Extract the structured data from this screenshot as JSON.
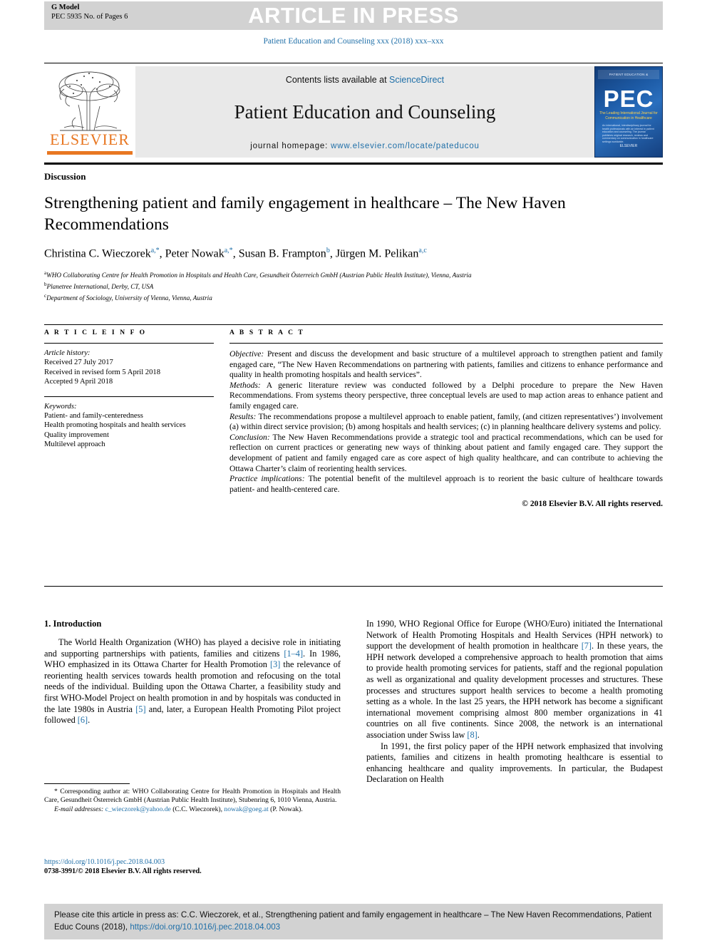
{
  "header": {
    "gmodel_label": "G Model",
    "gmodel_id": "PEC 5935 No. of Pages 6",
    "article_in_press": "ARTICLE IN PRESS",
    "journal_citation_line": "Patient Education and Counseling xxx (2018) xxx–xxx"
  },
  "masthead": {
    "contents_prefix": "Contents lists available at ",
    "contents_link": "ScienceDirect",
    "journal_name": "Patient Education and Counseling",
    "homepage_prefix": "journal homepage: ",
    "homepage_url": "www.elsevier.com/locate/pateducou",
    "publisher_logo_text": "ELSEVIER",
    "cover": {
      "top_strip": "PATIENT EDUCATION & COUNSELING",
      "big_title": "PEC",
      "subtitle": "The Leading International Journal\nfor Communication in Healthcare",
      "body_blurb": "An international, interdisciplinary journal for health professionals with an interest in patient education and counseling. The journal publishes original research, reviews and commentary on communication in healthcare settings worldwide.",
      "footer": "ELSEVIER"
    },
    "link_color": "#1f6fa8",
    "elsevier_orange": "#e87722"
  },
  "article": {
    "kind": "Discussion",
    "title": "Strengthening patient and family engagement in healthcare – The New Haven Recommendations",
    "authors": [
      {
        "name": "Christina C. Wieczorek",
        "sup": "a,*"
      },
      {
        "name": "Peter Nowak",
        "sup": "a,*"
      },
      {
        "name": "Susan B. Frampton",
        "sup": "b"
      },
      {
        "name": "Jürgen M. Pelikan",
        "sup": "a,c"
      }
    ],
    "affiliations": [
      {
        "marker": "a",
        "text": "WHO Collaborating Centre for Health Promotion in Hospitals and Health Care, Gesundheit Österreich GmbH (Austrian Public Health Institute), Vienna, Austria"
      },
      {
        "marker": "b",
        "text": "Planetree International, Derby, CT, USA"
      },
      {
        "marker": "c",
        "text": "Department of Sociology, University of Vienna, Vienna, Austria"
      }
    ]
  },
  "article_info": {
    "heading": "A R T I C L E   I N F O",
    "history_label": "Article history:",
    "history": [
      "Received 27 July 2017",
      "Received in revised form 5 April 2018",
      "Accepted 9 April 2018"
    ],
    "keywords_label": "Keywords:",
    "keywords": [
      "Patient- and family-centeredness",
      "Health promoting hospitals and health services",
      "Quality improvement",
      "Multilevel approach"
    ]
  },
  "abstract": {
    "heading": "A B S T R A C T",
    "sections": [
      {
        "label": "Objective:",
        "text": " Present and discuss the development and basic structure of a multilevel approach to strengthen patient and family engaged care, “The New Haven Recommendations on partnering with patients, families and citizens to enhance performance and quality in health promoting hospitals and health services”."
      },
      {
        "label": "Methods:",
        "text": " A generic literature review was conducted followed by a Delphi procedure to prepare the New Haven Recommendations. From systems theory perspective, three conceptual levels are used to map action areas to enhance patient and family engaged care."
      },
      {
        "label": "Results:",
        "text": " The recommendations propose a multilevel approach to enable patient, family, (and citizen representatives’) involvement (a) within direct service provision; (b) among hospitals and health services; (c) in planning healthcare delivery systems and policy."
      },
      {
        "label": "Conclusion:",
        "text": " The New Haven Recommendations provide a strategic tool and practical recommendations, which can be used for reflection on current practices or generating new ways of thinking about patient and family engaged care. They support the development of patient and family engaged care as core aspect of high quality healthcare, and can contribute to achieving the Ottawa Charter’s claim of reorienting health services."
      },
      {
        "label": "Practice implications:",
        "text": " The potential benefit of the multilevel approach is to reorient the basic culture of healthcare towards patient- and health-centered care."
      }
    ],
    "copyright": "© 2018 Elsevier B.V. All rights reserved."
  },
  "body": {
    "section_heading": "1. Introduction",
    "left_paragraph_1": "The World Health Organization (WHO) has played a decisive role in initiating and supporting partnerships with patients, families and citizens [1–4]. In 1986, WHO emphasized in its Ottawa Charter for Health Promotion [3] the relevance of reorienting health services towards health promotion and refocusing on the total needs of the individual. Building upon the Ottawa Charter, a feasibility study and first WHO-Model Project on health promotion in and by hospitals was conducted in the late 1980s in Austria [5] and, later, a European Health Promoting Pilot project followed [6].",
    "right_paragraph_1": "In 1990, WHO Regional Office for Europe (WHO/Euro) initiated the International Network of Health Promoting Hospitals and Health Services (HPH network) to support the development of health promotion in healthcare [7]. In these years, the HPH network developed a comprehensive approach to health promotion that aims to provide health promoting services for patients, staff and the regional population as well as organizational and quality development processes and structures. These processes and structures support health services to become a health promoting setting as a whole. In the last 25 years, the HPH network has become a significant international movement comprising almost 800 member organizations in 41 countries on all five continents. Since 2008, the network is an international association under Swiss law [8].",
    "right_paragraph_2": "In 1991, the first policy paper of the HPH network emphasized that involving patients, families and citizens in health promoting healthcare is essential to enhancing healthcare and quality improvements. In particular, the Budapest Declaration on Health"
  },
  "footnotes": {
    "corresponding": "* Corresponding author at: WHO Collaborating Centre for Health Promotion in Hospitals and Health Care, Gesundheit Österreich GmbH (Austrian Public Health Institute), Stubenring 6, 1010 Vienna, Austria.",
    "email_label": "E-mail addresses:",
    "email_1": "c_wieczorek@yahoo.de",
    "email_1_owner": " (C.C. Wieczorek), ",
    "email_2": "nowak@goeg.at",
    "email_2_owner": " (P. Nowak).",
    "doi": "https://doi.org/10.1016/j.pec.2018.04.003",
    "issn_line": "0738-3991/© 2018 Elsevier B.V. All rights reserved."
  },
  "cite_box": {
    "text_before": "Please cite this article in press as: C.C. Wieczorek, et al., Strengthening patient and family engagement in healthcare – The New Haven Recommendations, Patient Educ Couns (2018), ",
    "doi": "https://doi.org/10.1016/j.pec.2018.04.003"
  }
}
